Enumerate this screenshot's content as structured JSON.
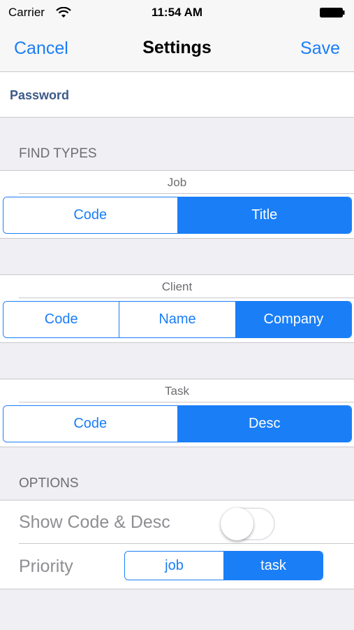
{
  "status_bar": {
    "carrier": "Carrier",
    "time": "11:54 AM"
  },
  "nav": {
    "cancel_label": "Cancel",
    "title": "Settings",
    "save_label": "Save"
  },
  "password": {
    "label": "Password"
  },
  "find_types": {
    "header": "FIND TYPES",
    "job": {
      "caption": "Job",
      "options": [
        "Code",
        "Title"
      ],
      "selected": "Title"
    },
    "client": {
      "caption": "Client",
      "options": [
        "Code",
        "Name",
        "Company"
      ],
      "selected": "Company"
    },
    "task": {
      "caption": "Task",
      "options": [
        "Code",
        "Desc"
      ],
      "selected": "Desc"
    }
  },
  "options": {
    "header": "OPTIONS",
    "show_code_desc": {
      "label": "Show Code & Desc",
      "on": false
    },
    "priority": {
      "label": "Priority",
      "options": [
        "job",
        "task"
      ],
      "selected": "task"
    }
  },
  "colors": {
    "accent": "#1a7ef7",
    "background": "#efeff4",
    "separator": "#c8c7cc"
  }
}
